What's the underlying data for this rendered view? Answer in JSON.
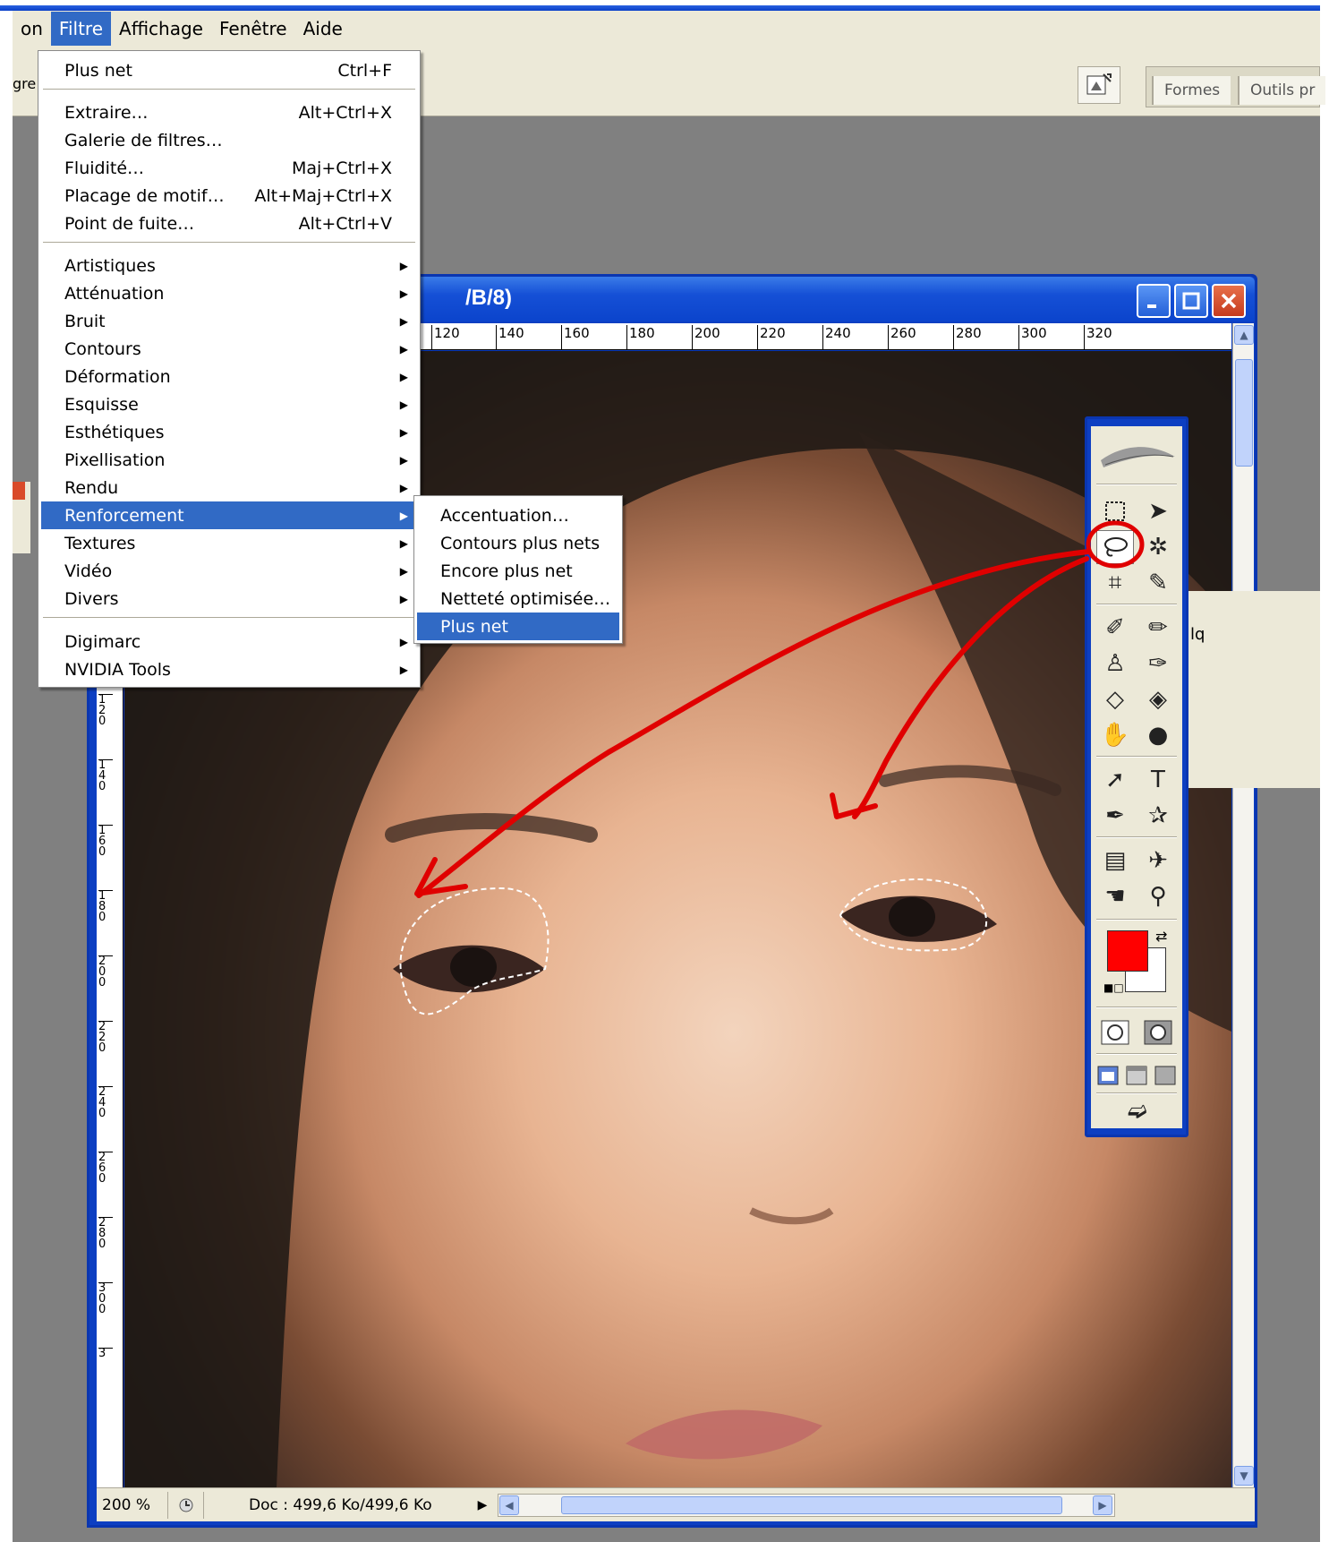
{
  "menubar": {
    "items": [
      {
        "label": "on",
        "active": false
      },
      {
        "label": "Filtre",
        "active": true
      },
      {
        "label": "Affichage",
        "active": false
      },
      {
        "label": "Fenêtre",
        "active": false
      },
      {
        "label": "Aide",
        "active": false
      }
    ]
  },
  "optionsbar": {
    "left_label": "gre:",
    "well_tabs": [
      "Formes",
      "Outils pr"
    ]
  },
  "filter_menu": {
    "items": [
      {
        "label": "Plus net",
        "shortcut": "Ctrl+F"
      },
      {
        "label": "Extraire…",
        "shortcut": "Alt+Ctrl+X"
      },
      {
        "label": "Galerie de filtres…",
        "shortcut": ""
      },
      {
        "label": "Fluidité…",
        "shortcut": "Maj+Ctrl+X"
      },
      {
        "label": "Placage de motif…",
        "shortcut": "Alt+Maj+Ctrl+X"
      },
      {
        "label": "Point de fuite…",
        "shortcut": "Alt+Ctrl+V"
      },
      {
        "label": "Artistiques"
      },
      {
        "label": "Atténuation"
      },
      {
        "label": "Bruit"
      },
      {
        "label": "Contours"
      },
      {
        "label": "Déformation"
      },
      {
        "label": "Esquisse"
      },
      {
        "label": "Esthétiques"
      },
      {
        "label": "Pixellisation"
      },
      {
        "label": "Rendu"
      },
      {
        "label": "Renforcement",
        "highlighted": true
      },
      {
        "label": "Textures"
      },
      {
        "label": "Vidéo"
      },
      {
        "label": "Divers"
      },
      {
        "label": "Digimarc"
      },
      {
        "label": "NVIDIA Tools"
      }
    ]
  },
  "submenu": {
    "items": [
      {
        "label": "Accentuation…"
      },
      {
        "label": "Contours plus nets"
      },
      {
        "label": "Encore plus net"
      },
      {
        "label": "Netteté optimisée…"
      },
      {
        "label": "Plus net",
        "highlighted": true
      }
    ]
  },
  "image_window": {
    "title": "/B/8)",
    "ruler_top": [
      "120",
      "140",
      "160",
      "180",
      "200",
      "220",
      "240",
      "260",
      "280",
      "300",
      "320"
    ],
    "ruler_left": [
      "120",
      "140",
      "160",
      "180",
      "200",
      "220",
      "240",
      "260",
      "280",
      "300",
      "3"
    ],
    "status": {
      "zoom": "200 %",
      "doc": "Doc : 499,6 Ko/499,6 Ko"
    }
  },
  "toolbox": {
    "foreground_color": "#ff0000",
    "background_color": "#ffffff",
    "selected_tool": "lasso-tool"
  },
  "right_panel": {
    "label": "lq"
  },
  "colors": {
    "menu_highlight": "#316ac5",
    "xp_blue": "#0d3fc2",
    "annotation_red": "#e00000"
  }
}
